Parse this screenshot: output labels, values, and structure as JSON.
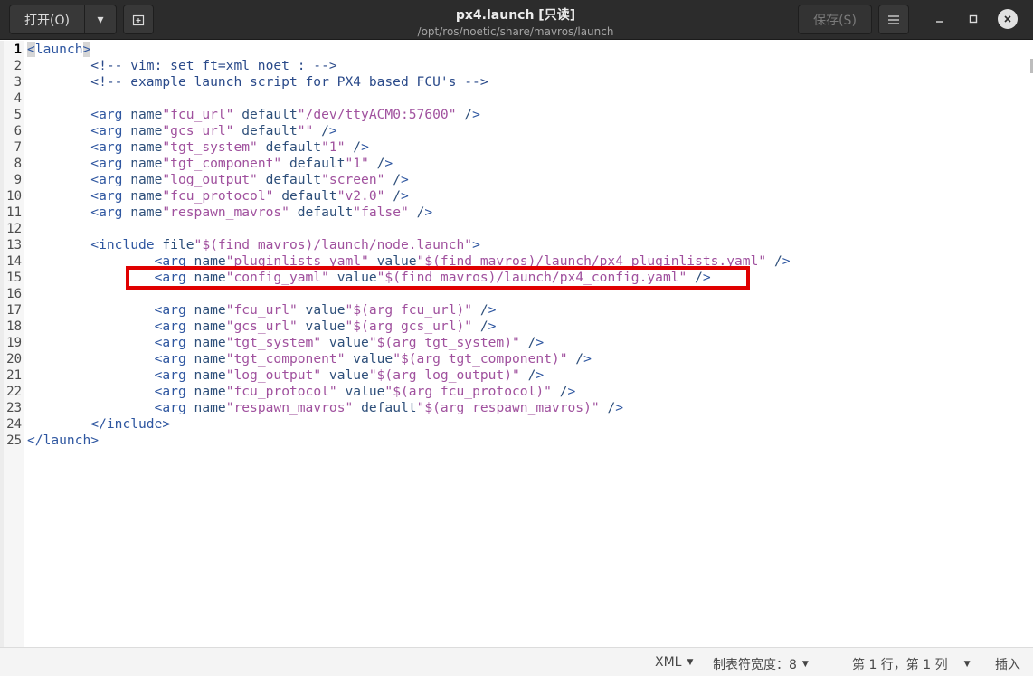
{
  "window": {
    "title": "px4.launch [只读]",
    "subtitle": "/opt/ros/noetic/share/mavros/launch"
  },
  "toolbar": {
    "open_label": "打开(O)",
    "save_label": "保存(S)"
  },
  "editor": {
    "current_line": 1,
    "highlighted_line": 15,
    "line_numbers": [
      "1",
      "2",
      "3",
      "4",
      "5",
      "6",
      "7",
      "8",
      "9",
      "10",
      "11",
      "12",
      "13",
      "14",
      "15",
      "16",
      "17",
      "18",
      "19",
      "20",
      "21",
      "22",
      "23",
      "24",
      "25"
    ],
    "lines": [
      "<launch>",
      "\t<!-- vim: set ft=xml noet : -->",
      "\t<!-- example launch script for PX4 based FCU's -->",
      "",
      "\t<arg name=\"fcu_url\" default=\"/dev/ttyACM0:57600\" />",
      "\t<arg name=\"gcs_url\" default=\"\" />",
      "\t<arg name=\"tgt_system\" default=\"1\" />",
      "\t<arg name=\"tgt_component\" default=\"1\" />",
      "\t<arg name=\"log_output\" default=\"screen\" />",
      "\t<arg name=\"fcu_protocol\" default=\"v2.0\" />",
      "\t<arg name=\"respawn_mavros\" default=\"false\" />",
      "",
      "\t<include file=\"$(find mavros)/launch/node.launch\">",
      "\t\t<arg name=\"pluginlists_yaml\" value=\"$(find mavros)/launch/px4_pluginlists.yaml\" />",
      "\t\t<arg name=\"config_yaml\" value=\"$(find mavros)/launch/px4_config.yaml\" />",
      "",
      "\t\t<arg name=\"fcu_url\" value=\"$(arg fcu_url)\" />",
      "\t\t<arg name=\"gcs_url\" value=\"$(arg gcs_url)\" />",
      "\t\t<arg name=\"tgt_system\" value=\"$(arg tgt_system)\" />",
      "\t\t<arg name=\"tgt_component\" value=\"$(arg tgt_component)\" />",
      "\t\t<arg name=\"log_output\" value=\"$(arg log_output)\" />",
      "\t\t<arg name=\"fcu_protocol\" value=\"$(arg fcu_protocol)\" />",
      "\t\t<arg name=\"respawn_mavros\" default=\"$(arg respawn_mavros)\" />",
      "\t</include>",
      "</launch>"
    ]
  },
  "statusbar": {
    "language": "XML",
    "tab_width": "制表符宽度：8",
    "position": "第 1 行，第 1 列",
    "insert_mode": "插入"
  },
  "colors": {
    "highlight_box": "#e00000",
    "header_bg": "#2c2c2c"
  }
}
